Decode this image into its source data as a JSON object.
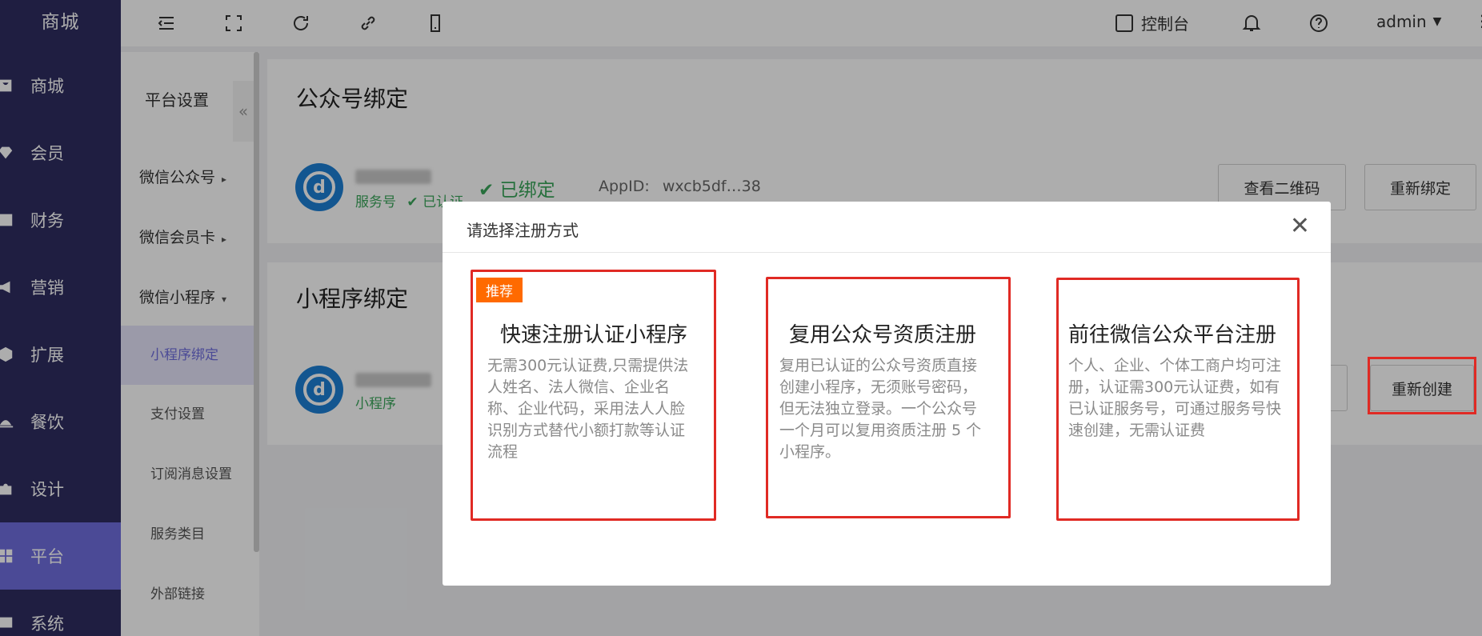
{
  "sidebar": {
    "brand": "商城",
    "items": [
      {
        "label": "商城",
        "icon": "bag-icon"
      },
      {
        "label": "会员",
        "icon": "diamond-icon"
      },
      {
        "label": "财务",
        "icon": "yen-icon"
      },
      {
        "label": "营销",
        "icon": "megaphone-icon"
      },
      {
        "label": "扩展",
        "icon": "cube-icon"
      },
      {
        "label": "餐饮",
        "icon": "dish-icon"
      },
      {
        "label": "设计",
        "icon": "puzzle-icon"
      },
      {
        "label": "平台",
        "icon": "grid-icon"
      },
      {
        "label": "系统",
        "icon": "settings-icon"
      }
    ],
    "active": "平台"
  },
  "submenu": {
    "title": "平台设置",
    "collapse_glyph": "«",
    "groups": [
      {
        "label": "微信公众号",
        "arrow": "▸"
      },
      {
        "label": "微信会员卡",
        "arrow": "▸"
      },
      {
        "label": "微信小程序",
        "arrow": "▾"
      }
    ],
    "items": [
      "小程序绑定",
      "支付设置",
      "订阅消息设置",
      "服务类目",
      "外部链接"
    ],
    "active": "小程序绑定"
  },
  "topbar": {
    "console_label": "控制台",
    "user": "admin",
    "user_caret": "▼",
    "more_glyph": "⋮"
  },
  "official_account": {
    "title": "公众号绑定",
    "type_label": "服务号",
    "verified_label": "已认证",
    "status": "已绑定",
    "appid_label": "AppID:",
    "appid_value": "wxcb5df…38",
    "btn_qrcode": "查看二维码",
    "btn_rebind": "重新绑定"
  },
  "miniprogram": {
    "title": "小程序绑定",
    "type_label": "小程序",
    "btn_recreate": "重新创建"
  },
  "modal": {
    "title": "请选择注册方式",
    "close_glyph": "✕",
    "options": [
      {
        "badge": "推荐",
        "title": "快速注册认证小程序",
        "desc": "无需300元认证费,只需提供法人姓名、法人微信、企业名称、企业代码，采用法人人脸识别方式替代小额打款等认证流程"
      },
      {
        "title": "复用公众号资质注册",
        "desc": "复用已认证的公众号资质直接创建小程序，无须账号密码，但无法独立登录。一个公众号一个月可以复用资质注册 5 个小程序。"
      },
      {
        "title": "前往微信公众平台注册",
        "desc": "个人、企业、个体工商户均可注册，认证需300元认证费，如有已认证服务号，可通过服务号快速创建，无需认证费"
      }
    ]
  },
  "colors": {
    "sidebar_bg": "#2e2d61",
    "accent": "#6f6ddd",
    "success": "#3aa65a",
    "highlight_border": "#e02a24",
    "badge": "#ff6a00"
  }
}
